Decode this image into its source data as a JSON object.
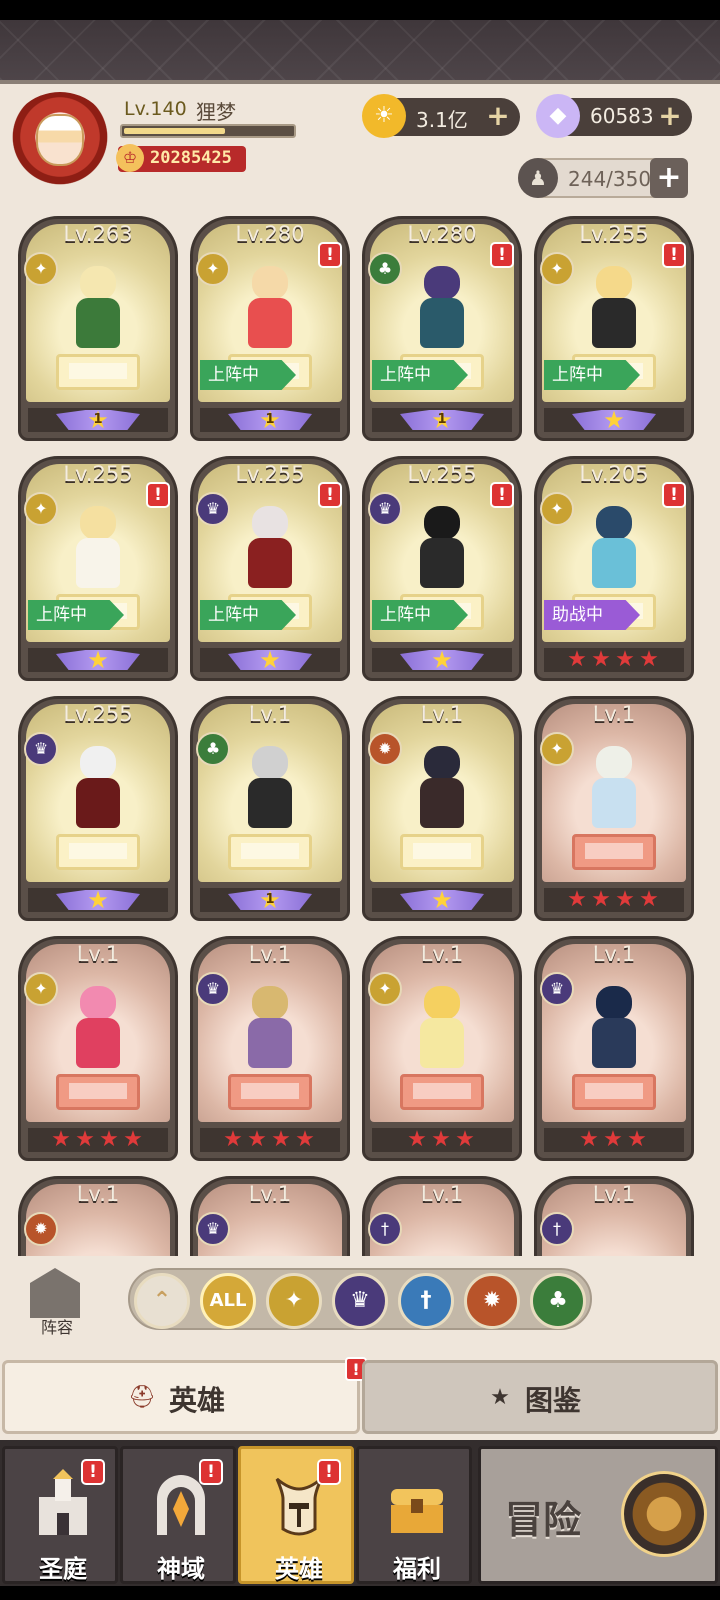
{
  "player": {
    "level": "Lv.140",
    "name": "狸梦",
    "exp_fraction": 0.6,
    "power": "20285425"
  },
  "currencies": {
    "gold": {
      "value": "3.1亿",
      "icon": "sun-coin-icon",
      "plus": "+"
    },
    "diamond": {
      "value": "60583",
      "icon": "diamond-icon",
      "plus": "+"
    }
  },
  "capacity": {
    "value": "244/350",
    "icon": "hero-silhouette-icon",
    "plus": "+"
  },
  "heroes": [
    {
      "level": "Lv.263",
      "class": "light",
      "tone": "gold",
      "alert": false,
      "status": "",
      "stars": "purple",
      "star_count": 1,
      "star_num": "1",
      "hair": "#f5e7b0",
      "outfit": "#3c7a3a"
    },
    {
      "level": "Lv.280",
      "class": "light",
      "tone": "gold",
      "alert": true,
      "status": "上阵中",
      "status_type": "on",
      "stars": "purple",
      "star_count": 1,
      "star_num": "1",
      "hair": "#f5d9a8",
      "outfit": "#e84f4f"
    },
    {
      "level": "Lv.280",
      "class": "nature",
      "tone": "gold",
      "alert": true,
      "status": "上阵中",
      "status_type": "on",
      "stars": "purple",
      "star_count": 1,
      "star_num": "1",
      "hair": "#4a3a7a",
      "outfit": "#2a5a6a"
    },
    {
      "level": "Lv.255",
      "class": "light",
      "tone": "gold",
      "alert": true,
      "status": "上阵中",
      "status_type": "on",
      "stars": "purple",
      "star_count": 1,
      "star_num": "",
      "hair": "#f5d98a",
      "outfit": "#2a2a2a"
    },
    {
      "level": "Lv.255",
      "class": "light",
      "tone": "gold",
      "alert": true,
      "status": "上阵中",
      "status_type": "on",
      "stars": "purple",
      "star_count": 1,
      "star_num": "",
      "hair": "#f5e0a0",
      "outfit": "#f8f4ea"
    },
    {
      "level": "Lv.255",
      "class": "dark",
      "tone": "gold",
      "alert": true,
      "status": "上阵中",
      "status_type": "on",
      "stars": "purple",
      "star_count": 1,
      "star_num": "",
      "hair": "#e8e2e2",
      "outfit": "#8a2020"
    },
    {
      "level": "Lv.255",
      "class": "dark",
      "tone": "gold",
      "alert": true,
      "status": "上阵中",
      "status_type": "on",
      "stars": "purple",
      "star_count": 1,
      "star_num": "",
      "hair": "#1a1a1a",
      "outfit": "#2a2a2a"
    },
    {
      "level": "Lv.205",
      "class": "light",
      "tone": "gold",
      "alert": true,
      "status": "助战中",
      "status_type": "help",
      "stars": "red",
      "star_count": 4,
      "star_num": "",
      "hair": "#2a4a6a",
      "outfit": "#6ac0d8"
    },
    {
      "level": "Lv.255",
      "class": "dark",
      "tone": "gold",
      "alert": false,
      "status": "",
      "stars": "purple",
      "star_count": 1,
      "star_num": "",
      "hair": "#f0f0f0",
      "outfit": "#6a1a1a"
    },
    {
      "level": "Lv.1",
      "class": "nature",
      "tone": "gold",
      "alert": false,
      "status": "",
      "stars": "purple",
      "star_count": 1,
      "star_num": "1",
      "hair": "#d0d0d0",
      "outfit": "#2a2a2a"
    },
    {
      "level": "Lv.1",
      "class": "fire",
      "tone": "gold",
      "alert": false,
      "status": "",
      "stars": "purple",
      "star_count": 1,
      "star_num": "",
      "hair": "#2a2a3a",
      "outfit": "#3a2a2a"
    },
    {
      "level": "Lv.1",
      "class": "light",
      "tone": "red",
      "alert": false,
      "status": "",
      "stars": "red",
      "star_count": 4,
      "star_num": "",
      "hair": "#eef0e8",
      "outfit": "#c8e0f0"
    },
    {
      "level": "Lv.1",
      "class": "light",
      "tone": "red",
      "alert": false,
      "status": "",
      "stars": "red",
      "star_count": 4,
      "star_num": "",
      "hair": "#f28ab0",
      "outfit": "#e04060"
    },
    {
      "level": "Lv.1",
      "class": "dark",
      "tone": "red",
      "alert": false,
      "status": "",
      "stars": "red",
      "star_count": 4,
      "star_num": "",
      "hair": "#d8b870",
      "outfit": "#8a6aa8"
    },
    {
      "level": "Lv.1",
      "class": "light",
      "tone": "red",
      "alert": false,
      "status": "",
      "stars": "red",
      "star_count": 3,
      "star_num": "",
      "hair": "#f5d060",
      "outfit": "#f5e8a0"
    },
    {
      "level": "Lv.1",
      "class": "dark",
      "tone": "red",
      "alert": false,
      "status": "",
      "stars": "red",
      "star_count": 3,
      "star_num": "",
      "hair": "#1a2a4a",
      "outfit": "#2a3a5a"
    },
    {
      "level": "Lv.1",
      "class": "fire",
      "tone": "red",
      "alert": false,
      "status": "",
      "stars": "red",
      "star_count": 0,
      "star_num": "",
      "hair": "",
      "outfit": ""
    },
    {
      "level": "Lv.1",
      "class": "dark",
      "tone": "red",
      "alert": false,
      "status": "",
      "stars": "red",
      "star_count": 0,
      "star_num": "",
      "hair": "",
      "outfit": ""
    },
    {
      "level": "Lv.1",
      "class": "water",
      "tone": "red",
      "alert": false,
      "status": "",
      "stars": "red",
      "star_count": 0,
      "star_num": "",
      "hair": "",
      "outfit": ""
    },
    {
      "level": "Lv.1",
      "class": "water",
      "tone": "red",
      "alert": false,
      "status": "",
      "stars": "red",
      "star_count": 0,
      "star_num": "",
      "hair": "",
      "outfit": ""
    }
  ],
  "filters": {
    "lineup_label": "阵容",
    "buttons": [
      {
        "name": "sort-up",
        "label": "⌃",
        "color": "#e8e0d2"
      },
      {
        "name": "all",
        "label": "ALL",
        "color": "#d4a838"
      },
      {
        "name": "light",
        "label": "✦",
        "color": "#c9a232"
      },
      {
        "name": "dark",
        "label": "♛",
        "color": "#4a3a7a"
      },
      {
        "name": "water",
        "label": "†",
        "color": "#3a7ab8"
      },
      {
        "name": "fire",
        "label": "✹",
        "color": "#b8542a"
      },
      {
        "name": "nature",
        "label": "♣",
        "color": "#3b7d3b"
      }
    ]
  },
  "tabs": {
    "heroes": {
      "label": "英雄",
      "alert": "!"
    },
    "codex": {
      "label": "图鉴"
    }
  },
  "nav": {
    "items": [
      {
        "label": "圣庭",
        "alert": "!"
      },
      {
        "label": "神域",
        "alert": "!"
      },
      {
        "label": "英雄",
        "alert": "!"
      },
      {
        "label": "福利",
        "alert": ""
      }
    ],
    "adventure_label": "冒险"
  }
}
